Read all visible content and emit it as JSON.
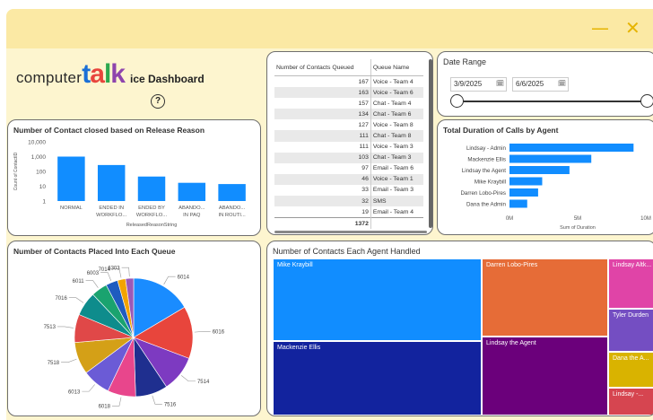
{
  "window": {
    "minimize_glyph": "—",
    "close_glyph": "✕",
    "accent": "#e6b400"
  },
  "logo": {
    "word1": "computer",
    "word2": "talk",
    "subtitle": "ice Dashboard",
    "help_glyph": "?"
  },
  "release_chart": {
    "title": "Number of Contact closed based on Release Reason",
    "xlabel": "ReleasedReasonString",
    "ylabel": "Count of ContactID",
    "ytick_labels": [
      "10,000",
      "1,000",
      "100",
      "10",
      "1"
    ],
    "bar_color": "#118dff",
    "categories": [
      "NORMAL",
      "ENDED IN\nWORKFLO...",
      "ENDED BY\nWORKFLO...",
      "ABANDO...\nIN PAQ",
      "ABANDO...\nIN ROUTI..."
    ]
  },
  "queue_table": {
    "headers": [
      "Number of Contacts Queued",
      "Queue Name"
    ],
    "rows": [
      [
        "167",
        "Voice - Team 4"
      ],
      [
        "163",
        "Voice - Team 6"
      ],
      [
        "157",
        "Chat - Team 4"
      ],
      [
        "134",
        "Chat - Team 6"
      ],
      [
        "127",
        "Voice - Team 8"
      ],
      [
        "111",
        "Chat - Team 8"
      ],
      [
        "111",
        "Voice - Team 3"
      ],
      [
        "103",
        "Chat - Team 3"
      ],
      [
        "97",
        "Email - Team 6"
      ],
      [
        "46",
        "Voice - Team 1"
      ],
      [
        "33",
        "Email - Team 3"
      ],
      [
        "32",
        "SMS"
      ],
      [
        "19",
        "Email - Team 4"
      ]
    ],
    "total": "1372"
  },
  "date_range": {
    "title": "Date Range",
    "start": "3/9/2025",
    "end": "6/6/2025",
    "calendar_glyph": "🗓"
  },
  "duration_chart": {
    "title": "Total Duration of Calls by Agent",
    "xlabel": "Sum of Duration",
    "xtick_labels": [
      "0M",
      "5M",
      "10M"
    ],
    "bar_color": "#118dff",
    "agents": [
      "Lindsay - Admin",
      "Mackenzie Ellis",
      "Lindsay the Agent",
      "Mike Kraybill",
      "Darren Lobo-Pires",
      "Dana the Admin"
    ]
  },
  "pie_panel": {
    "title": "Number of Contacts Placed Into Each Queue",
    "labels": [
      "6014",
      "6016",
      "7514",
      "7516",
      "6018",
      "6013",
      "7518",
      "7513",
      "7016",
      "6011",
      "6003",
      "7014",
      "6303"
    ]
  },
  "treemap": {
    "title": "Number of Contacts Each Agent Handled",
    "tiles": [
      "Mike Kraybill",
      "Mackenzie Ellis",
      "Darren Lobo-Pires",
      "Lindsay the Agent",
      "Lindsay Altk...",
      "Tyler Durden",
      "Dana the A...",
      "Lindsay -..."
    ]
  },
  "chart_data": [
    {
      "type": "bar",
      "title": "Number of Contact closed based on Release Reason",
      "categories": [
        "NORMAL",
        "ENDED IN WORKFLO...",
        "ENDED BY WORKFLO...",
        "ABANDO... IN PAQ",
        "ABANDO... IN ROUTI..."
      ],
      "values": [
        1000,
        270,
        45,
        17,
        14
      ],
      "ylabel": "Count of ContactID",
      "xlabel": "ReleasedReasonString",
      "yscale": "log",
      "ylim": [
        1,
        10000
      ]
    },
    {
      "type": "bar",
      "orientation": "horizontal",
      "title": "Total Duration of Calls by Agent",
      "categories": [
        "Lindsay - Admin",
        "Mackenzie Ellis",
        "Lindsay the Agent",
        "Mike Kraybill",
        "Darren Lobo-Pires",
        "Dana the Admin"
      ],
      "values": [
        9.1,
        6.0,
        4.4,
        2.4,
        2.1,
        1.3
      ],
      "xlabel": "Sum of Duration",
      "unit": "M",
      "xlim": [
        0,
        10
      ]
    },
    {
      "type": "pie",
      "title": "Number of Contacts Placed Into Each Queue",
      "labels": [
        "6014",
        "6016",
        "7514",
        "7516",
        "6018",
        "6013",
        "7518",
        "7513",
        "7016",
        "6011",
        "6003",
        "7014",
        "6303"
      ],
      "values": [
        15,
        13,
        9,
        8,
        7,
        7,
        8,
        7,
        6,
        4,
        3,
        2,
        2
      ],
      "colors": [
        "#1a8cff",
        "#e8453c",
        "#7d3ac1",
        "#1f2f8f",
        "#e8468c",
        "#6b5bd6",
        "#d4a017",
        "#e04848",
        "#0e8c8c",
        "#1aa36f",
        "#1f5cbf",
        "#f2a300",
        "#9b59b6"
      ]
    },
    {
      "type": "treemap",
      "title": "Number of Contacts Each Agent Handled",
      "labels": [
        "Mike Kraybill",
        "Mackenzie Ellis",
        "Darren Lobo-Pires",
        "Lindsay the Agent",
        "Lindsay Altk...",
        "Tyler Durden",
        "Dana the A...",
        "Lindsay -..."
      ],
      "colors": [
        "#118dff",
        "#12239e",
        "#e66c37",
        "#6b007b",
        "#e044a7",
        "#744ec2",
        "#d9b300",
        "#d64550"
      ]
    }
  ]
}
